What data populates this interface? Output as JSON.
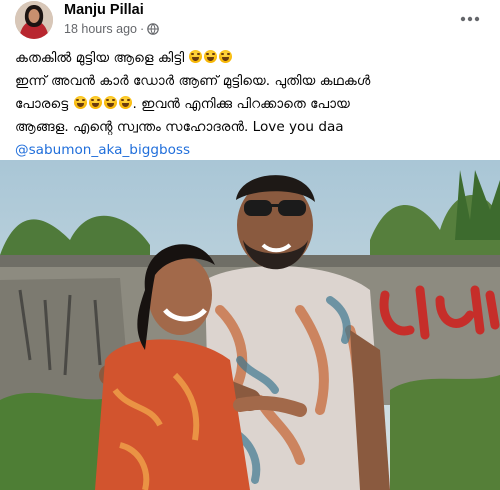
{
  "post": {
    "author": "Manju Pillai",
    "time": "18 hours ago",
    "separator": "·",
    "lines": [
      "കതകിൽ മുട്ടിയ ആളെ കിട്ടി",
      "ഇന്ന് അവൻ കാർ ഡോർ ആണ് മുട്ടിയെ. പുതിയ കഥകൾ",
      "പോരട്ടെ",
      ". ഇവൻ എനിക്കു പിറക്കാതെ പോയ",
      "ആങ്ങള. എന്റെ സ്വന്തം സഹോദരൻ. Love you daa"
    ],
    "mention": "@sabumon_aka_biggboss"
  },
  "icons": {
    "more": "more-horizontal-icon",
    "privacy": "globe-icon",
    "emoji": "laughing-emoji-icon"
  },
  "colors": {
    "name": "#050505",
    "meta": "#65676b",
    "link": "#216fdb"
  }
}
